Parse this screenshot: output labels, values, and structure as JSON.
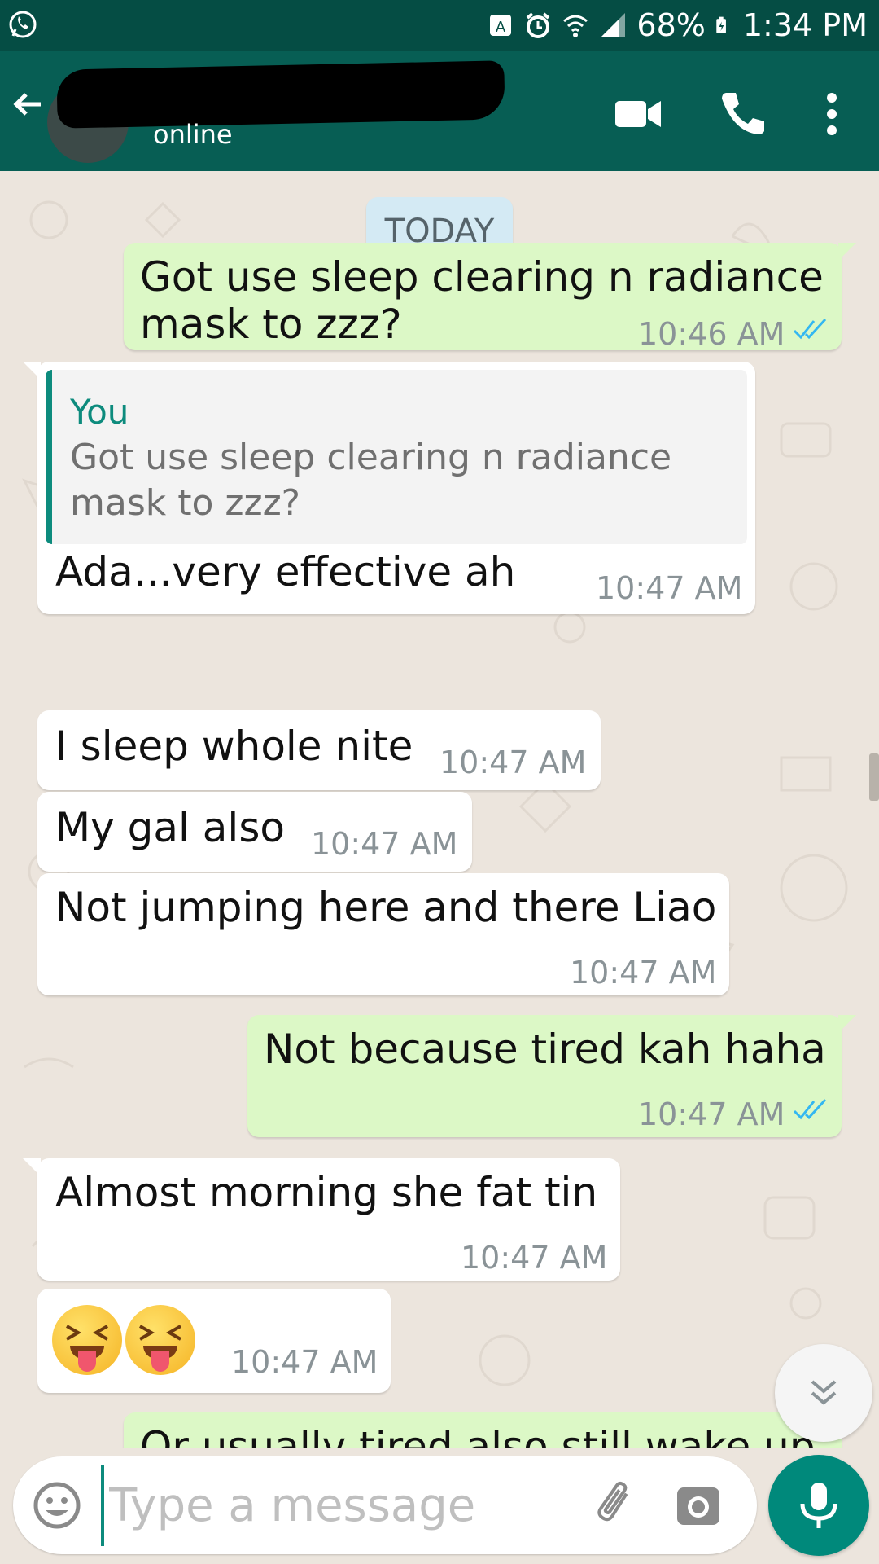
{
  "status_bar": {
    "battery": "68%",
    "time": "1:34 PM"
  },
  "header": {
    "contact_name": "",
    "status": "online"
  },
  "chat": {
    "date_label": "TODAY",
    "messages": [
      {
        "direction": "out",
        "text_lines": [
          "Got use sleep clearing n radiance",
          "mask to zzz?"
        ],
        "time": "10:46 AM",
        "read": true
      },
      {
        "direction": "in",
        "quote_author": "You",
        "quote_text": "Got use sleep clearing n radiance mask to zzz?",
        "text": "Ada...very effective ah",
        "time": "10:47 AM"
      },
      {
        "direction": "in",
        "text": "I sleep whole nite",
        "time": "10:47 AM"
      },
      {
        "direction": "in",
        "text": "My gal also",
        "time": "10:47 AM"
      },
      {
        "direction": "in",
        "text": "Not jumping here and there Liao",
        "time": "10:47 AM"
      },
      {
        "direction": "out",
        "text": "Not because tired kah haha",
        "time": "10:47 AM",
        "read": true
      },
      {
        "direction": "in",
        "text": "Almost morning she fat tin",
        "time": "10:47 AM"
      },
      {
        "direction": "in",
        "text": "😝😝",
        "time": "10:47 AM"
      },
      {
        "direction": "out",
        "text": "Or usually tired also still wake up"
      }
    ]
  },
  "input": {
    "placeholder": "Type a message",
    "value": ""
  },
  "colors": {
    "header": "#075e54",
    "status_bar": "#054d44",
    "outgoing_bubble": "#dcf8c6",
    "incoming_bubble": "#ffffff",
    "chat_background": "#ece5dd",
    "accent": "#00897b",
    "read_ticks": "#34b7f1"
  },
  "icons": [
    "whatsapp-icon",
    "nfc-icon",
    "alarm-icon",
    "wifi-icon",
    "signal-icon",
    "battery-icon",
    "back-arrow-icon",
    "video-call-icon",
    "phone-icon",
    "more-options-icon",
    "read-ticks-icon",
    "chevron-down-icon",
    "emoji-icon",
    "attach-icon",
    "camera-icon",
    "mic-icon"
  ]
}
